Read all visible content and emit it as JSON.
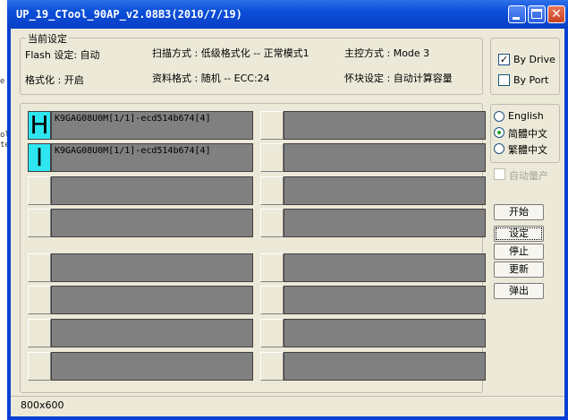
{
  "background": {
    "fragment_1": "e r.i",
    "fragment_2": "ol\nte"
  },
  "window": {
    "title": "UP_19_CTool_90AP_v2.08B3(2010/7/19)"
  },
  "info": {
    "legend": "当前设定",
    "flash_setting": "Flash 设定: 自动",
    "scan_mode": "扫描方式 : 低级格式化 -- 正常模式1",
    "controller_mode": "主控方式 : Mode 3",
    "format": "格式化 : 开启",
    "data_format": "资料格式 : 随机 -- ECC:24",
    "bad_block": "怀块设定 : 自动计算容量"
  },
  "drive_mode": {
    "by_drive": "By Drive",
    "by_drive_checked": true,
    "by_port": "By Port",
    "by_port_checked": false
  },
  "language": {
    "english": "English",
    "simplified": "简體中文",
    "traditional": "繁體中文",
    "selected": "simplified"
  },
  "auto_mass_production": "自动量产",
  "ports_left": [
    {
      "letter": "H",
      "text": "K9GAG08U0M[1/1]-ecd514b674[4]",
      "active": true
    },
    {
      "letter": "I",
      "text": "K9GAG08U0M[1/1]-ecd514b674[4]",
      "active": true
    },
    {
      "letter": "",
      "text": "",
      "active": false
    },
    {
      "letter": "",
      "text": "",
      "active": false
    },
    {
      "letter": "",
      "text": "",
      "active": false
    },
    {
      "letter": "",
      "text": "",
      "active": false
    },
    {
      "letter": "",
      "text": "",
      "active": false
    },
    {
      "letter": "",
      "text": "",
      "active": false
    }
  ],
  "ports_right": [
    {
      "letter": "",
      "text": ""
    },
    {
      "letter": "",
      "text": ""
    },
    {
      "letter": "",
      "text": ""
    },
    {
      "letter": "",
      "text": ""
    },
    {
      "letter": "",
      "text": ""
    },
    {
      "letter": "",
      "text": ""
    },
    {
      "letter": "",
      "text": ""
    },
    {
      "letter": "",
      "text": ""
    }
  ],
  "buttons": {
    "start": "开始",
    "settings": "设定",
    "stop": "停止",
    "refresh": "更新",
    "eject": "弹出"
  },
  "status": {
    "resolution": "800x600"
  },
  "colors": {
    "titlebar": "#0b4fd8",
    "client": "#ece9d8",
    "active_port": "#2ee6f0",
    "port_bar": "#808080"
  }
}
